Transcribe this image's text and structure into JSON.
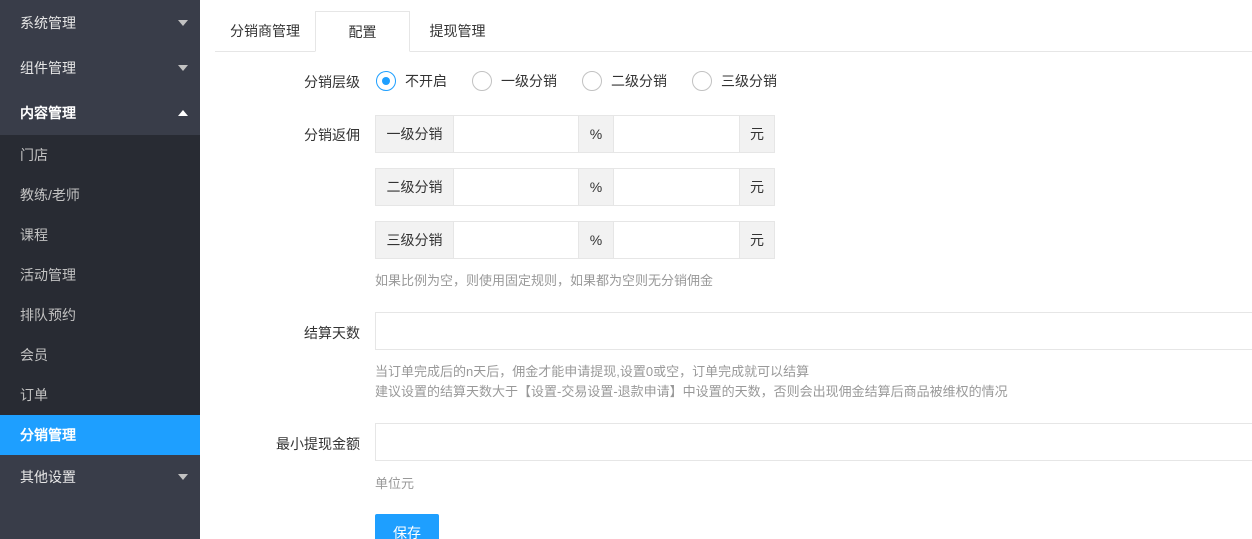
{
  "sidebar": {
    "groups": [
      {
        "label": "系统管理"
      },
      {
        "label": "组件管理"
      },
      {
        "label": "内容管理"
      }
    ],
    "items": [
      {
        "label": "门店"
      },
      {
        "label": "教练/老师"
      },
      {
        "label": "课程"
      },
      {
        "label": "活动管理"
      },
      {
        "label": "排队预约"
      },
      {
        "label": "会员"
      },
      {
        "label": "订单"
      },
      {
        "label": "分销管理"
      }
    ],
    "other": {
      "label": "其他设置"
    }
  },
  "tabs": [
    {
      "label": "分销商管理"
    },
    {
      "label": "配置"
    },
    {
      "label": "提现管理"
    }
  ],
  "form": {
    "level_label": "分销层级",
    "levels": [
      "不开启",
      "一级分销",
      "二级分销",
      "三级分销"
    ],
    "selected_level": "不开启",
    "commission_label": "分销返佣",
    "commission_rows": [
      {
        "name": "一级分销",
        "percent_unit": "%",
        "amount_unit": "元",
        "percent_value": "",
        "amount_value": ""
      },
      {
        "name": "二级分销",
        "percent_unit": "%",
        "amount_unit": "元",
        "percent_value": "",
        "amount_value": ""
      },
      {
        "name": "三级分销",
        "percent_unit": "%",
        "amount_unit": "元",
        "percent_value": "",
        "amount_value": ""
      }
    ],
    "commission_hint": "如果比例为空，则使用固定规则，如果都为空则无分销佣金",
    "settle_label": "结算天数",
    "settle_value": "",
    "settle_hint_1": "当订单完成后的n天后，佣金才能申请提现,设置0或空，订单完成就可以结算",
    "settle_hint_2": "建议设置的结算天数大于【设置-交易设置-退款申请】中设置的天数，否则会出现佣金结算后商品被维权的情况",
    "min_withdraw_label": "最小提现金额",
    "min_withdraw_value": "",
    "min_withdraw_hint": "单位元",
    "save_label": "保存"
  },
  "colors": {
    "sidebar_bg": "#393d49",
    "submenu_bg": "#282b33",
    "accent": "#1e9fff"
  }
}
